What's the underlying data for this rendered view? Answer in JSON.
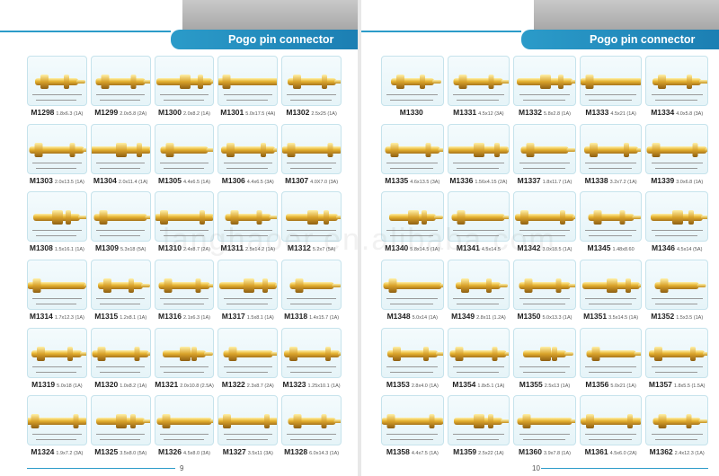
{
  "watermark": "langhaoer.en.alibaba.com",
  "left": {
    "title": "Pogo pin connector",
    "page_number": "9",
    "items": [
      {
        "code": "M1298",
        "spec": "1.8x6.3 (1A)"
      },
      {
        "code": "M1299",
        "spec": "2.0x5.8 (2A)"
      },
      {
        "code": "M1300",
        "spec": "2.0x8.2 (1A)"
      },
      {
        "code": "M1301",
        "spec": "5.0x17.5 (4A)"
      },
      {
        "code": "M1302",
        "spec": "2.5x25 (1A)"
      },
      {
        "code": "M1303",
        "spec": "2.0x13.5 (1A)"
      },
      {
        "code": "M1304",
        "spec": "2.0x11.4 (1A)"
      },
      {
        "code": "M1305",
        "spec": "4.4x6.5 (1A)"
      },
      {
        "code": "M1306",
        "spec": "4.4x6.5 (3A)"
      },
      {
        "code": "M1307",
        "spec": "4.0X7.0 (3A)"
      },
      {
        "code": "M1308",
        "spec": "1.5x16.1 (1A)"
      },
      {
        "code": "M1309",
        "spec": "5.3x18 (5A)"
      },
      {
        "code": "M1310",
        "spec": "2.4x8.7 (2A)"
      },
      {
        "code": "M1311",
        "spec": "2.5x14.2 (1A)"
      },
      {
        "code": "M1312",
        "spec": "5.2x7 (5A)"
      },
      {
        "code": "M1314",
        "spec": "1.7x12.3 (1A)"
      },
      {
        "code": "M1315",
        "spec": "1.2x8.1 (1A)"
      },
      {
        "code": "M1316",
        "spec": "2.1x6.3 (1A)"
      },
      {
        "code": "M1317",
        "spec": "1.5x8.1 (1A)"
      },
      {
        "code": "M1318",
        "spec": "1.4x15.7 (1A)"
      },
      {
        "code": "M1319",
        "spec": "5.0x18 (1A)"
      },
      {
        "code": "M1320",
        "spec": "1.0x8.2 (1A)"
      },
      {
        "code": "M1321",
        "spec": "2.0x10.8 (2.5A)"
      },
      {
        "code": "M1322",
        "spec": "2.3x8.7 (2A)"
      },
      {
        "code": "M1323",
        "spec": "1.25x10.1 (1A)"
      },
      {
        "code": "M1324",
        "spec": "1.9x7.2 (3A)"
      },
      {
        "code": "M1325",
        "spec": "3.5x8.0 (5A)"
      },
      {
        "code": "M1326",
        "spec": "4.5x8.0 (3A)"
      },
      {
        "code": "M1327",
        "spec": "3.5x11 (3A)"
      },
      {
        "code": "M1328",
        "spec": "6.0x14.3 (1A)"
      }
    ]
  },
  "right": {
    "title": "Pogo pin connector",
    "page_number": "10",
    "items": [
      {
        "code": "M1330",
        "spec": ""
      },
      {
        "code": "M1331",
        "spec": "4.5x12 (3A)"
      },
      {
        "code": "M1332",
        "spec": "5.8x2.8 (1A)"
      },
      {
        "code": "M1333",
        "spec": "4.5x21 (1A)"
      },
      {
        "code": "M1334",
        "spec": "4.0x5.8 (3A)"
      },
      {
        "code": "M1335",
        "spec": "4.6x13.5 (3A)"
      },
      {
        "code": "M1336",
        "spec": "1.56x4.15 (2A)"
      },
      {
        "code": "M1337",
        "spec": "1.8x11.7 (1A)"
      },
      {
        "code": "M1338",
        "spec": "3.2x7.2 (1A)"
      },
      {
        "code": "M1339",
        "spec": "3.0x6.8 (1A)"
      },
      {
        "code": "M1340",
        "spec": "5.8x14.5 (1A)"
      },
      {
        "code": "M1341",
        "spec": "4.5x14.5"
      },
      {
        "code": "M1342",
        "spec": "3.0x18.5 (1A)"
      },
      {
        "code": "M1345",
        "spec": "1.48x8.60"
      },
      {
        "code": "M1346",
        "spec": "4.5x14 (5A)"
      },
      {
        "code": "M1348",
        "spec": "5.0x14 (1A)"
      },
      {
        "code": "M1349",
        "spec": "2.8x11 (1.2A)"
      },
      {
        "code": "M1350",
        "spec": "5.0x13.3 (1A)"
      },
      {
        "code": "M1351",
        "spec": "3.5x14.5 (1A)"
      },
      {
        "code": "M1352",
        "spec": "1.5x3.5 (1A)"
      },
      {
        "code": "M1353",
        "spec": "2.8x4.0 (1A)"
      },
      {
        "code": "M1354",
        "spec": "1.8x5.1 (1A)"
      },
      {
        "code": "M1355",
        "spec": "2.5x13 (1A)"
      },
      {
        "code": "M1356",
        "spec": "5.0x21 (1A)"
      },
      {
        "code": "M1357",
        "spec": "1.8x5.5 (1.5A)"
      },
      {
        "code": "M1358",
        "spec": "4.4x7.5 (1A)"
      },
      {
        "code": "M1359",
        "spec": "2.5x22 (1A)"
      },
      {
        "code": "M1360",
        "spec": "3.9x7.8 (1A)"
      },
      {
        "code": "M1361",
        "spec": "4.5x6.0 (2A)"
      },
      {
        "code": "M1362",
        "spec": "2.4x12.3 (1A)"
      }
    ]
  }
}
